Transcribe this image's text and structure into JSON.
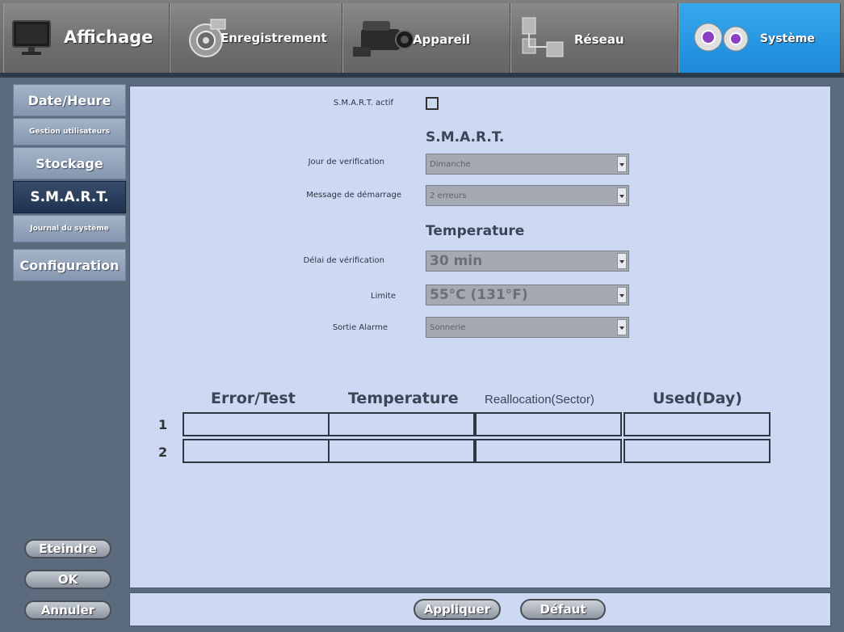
{
  "tabs": [
    {
      "label": "Affichage",
      "icon": "monitor-icon"
    },
    {
      "label": "Enregistrement",
      "icon": "record-icon"
    },
    {
      "label": "Appareil",
      "icon": "camera-icon"
    },
    {
      "label": "Réseau",
      "icon": "network-icon"
    },
    {
      "label": "Système",
      "icon": "gears-icon"
    }
  ],
  "active_tab": "Système",
  "sidebar": {
    "items": [
      {
        "label": "Date/Heure"
      },
      {
        "label": "Gestion utilisateurs"
      },
      {
        "label": "Stockage"
      },
      {
        "label": "S.M.A.R.T."
      },
      {
        "label": "Journal du système"
      },
      {
        "label": "Configuration"
      }
    ],
    "active": "S.M.A.R.T.",
    "buttons": {
      "shutdown": "Eteindre",
      "ok": "OK",
      "cancel": "Annuler"
    }
  },
  "form": {
    "smart_active_label": "S.M.A.R.T. actif",
    "smart_active_checked": false,
    "smart_section_title": "S.M.A.R.T.",
    "check_day_label": "Jour de verification",
    "check_day_value": "Dimanche",
    "startup_msg_label": "Message de démarrage",
    "startup_msg_value": "2 erreurs",
    "temperature_section_title": "Temperature",
    "check_delay_label": "Délai de vérification",
    "check_delay_value": "30 min",
    "limit_label": "Limite",
    "limit_value": "55°C (131°F)",
    "alarm_out_label": "Sortie Alarme",
    "alarm_out_value": "Sonnerie"
  },
  "table": {
    "columns": [
      "Error/Test",
      "Temperature",
      "Reallocation(Sector)",
      "Used(Day)"
    ],
    "rows": [
      {
        "num": "1",
        "cells": [
          "",
          "",
          "",
          ""
        ]
      },
      {
        "num": "2",
        "cells": [
          "",
          "",
          "",
          ""
        ]
      }
    ]
  },
  "actions": {
    "apply": "Appliquer",
    "default": "Défaut"
  },
  "colors": {
    "active_tab": "#1d8ad9",
    "panel": "#cdd9f3",
    "active_side": "#1f3350"
  }
}
